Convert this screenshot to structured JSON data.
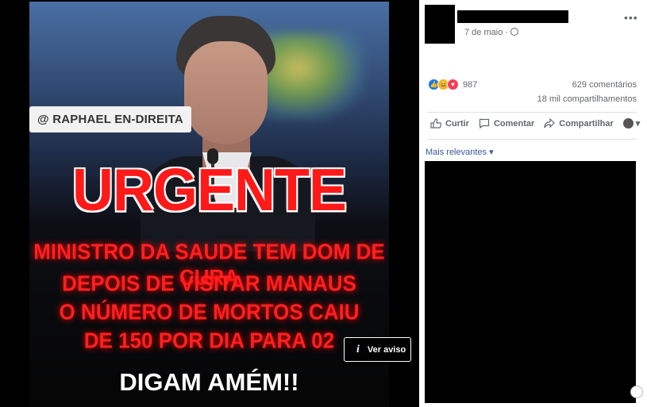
{
  "image": {
    "tag": "@ RAPHAEL EN-DIREITA",
    "headline": "URGENTE",
    "lines": [
      "MINISTRO DA SAUDE TEM DOM DE CURA",
      "DEPOIS DE VISITAR MANAUS",
      "O NÚMERO DE MORTOS CAIU",
      "DE 150 POR DIA PARA 02"
    ],
    "closing": "DIGAM AMÉM!!",
    "warning_button": "Ver aviso",
    "warning_icon": "i"
  },
  "post": {
    "date": "7 de maio",
    "more_label": "•••",
    "reaction_count": "987",
    "comments": "629 comentários",
    "shares": "18 mil compartilhamentos",
    "actions": {
      "like": "Curtir",
      "comment": "Comentar",
      "share": "Compartilhar",
      "dropdown": "▾"
    },
    "sort_label": "Mais relevantes ▾"
  },
  "colors": {
    "headline": "#ff1a1a",
    "link": "#385898",
    "like": "#1877f2"
  }
}
